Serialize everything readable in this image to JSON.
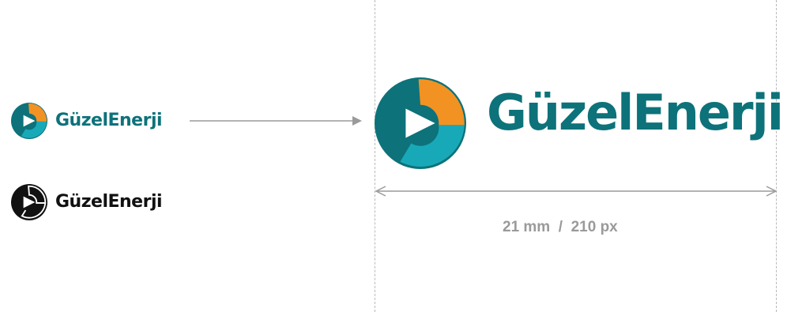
{
  "brand": {
    "name": "GüzelEnerji",
    "colors": {
      "teal": "#0d727a",
      "cyan": "#18a9b8",
      "orange": "#f29223",
      "black": "#111111",
      "guide": "#b9b9b9",
      "arrow": "#9a9a9a"
    }
  },
  "logos": {
    "small_color": {
      "icon": "guzelenerji-logo-mark-icon",
      "text": "GüzelEnerji"
    },
    "small_black": {
      "icon": "guzelenerji-logo-mark-black-icon",
      "text": "GüzelEnerji"
    },
    "large_color": {
      "icon": "guzelenerji-logo-mark-icon",
      "text": "GüzelEnerji"
    }
  },
  "measurement": {
    "label": "21 mm  /  210 px"
  }
}
